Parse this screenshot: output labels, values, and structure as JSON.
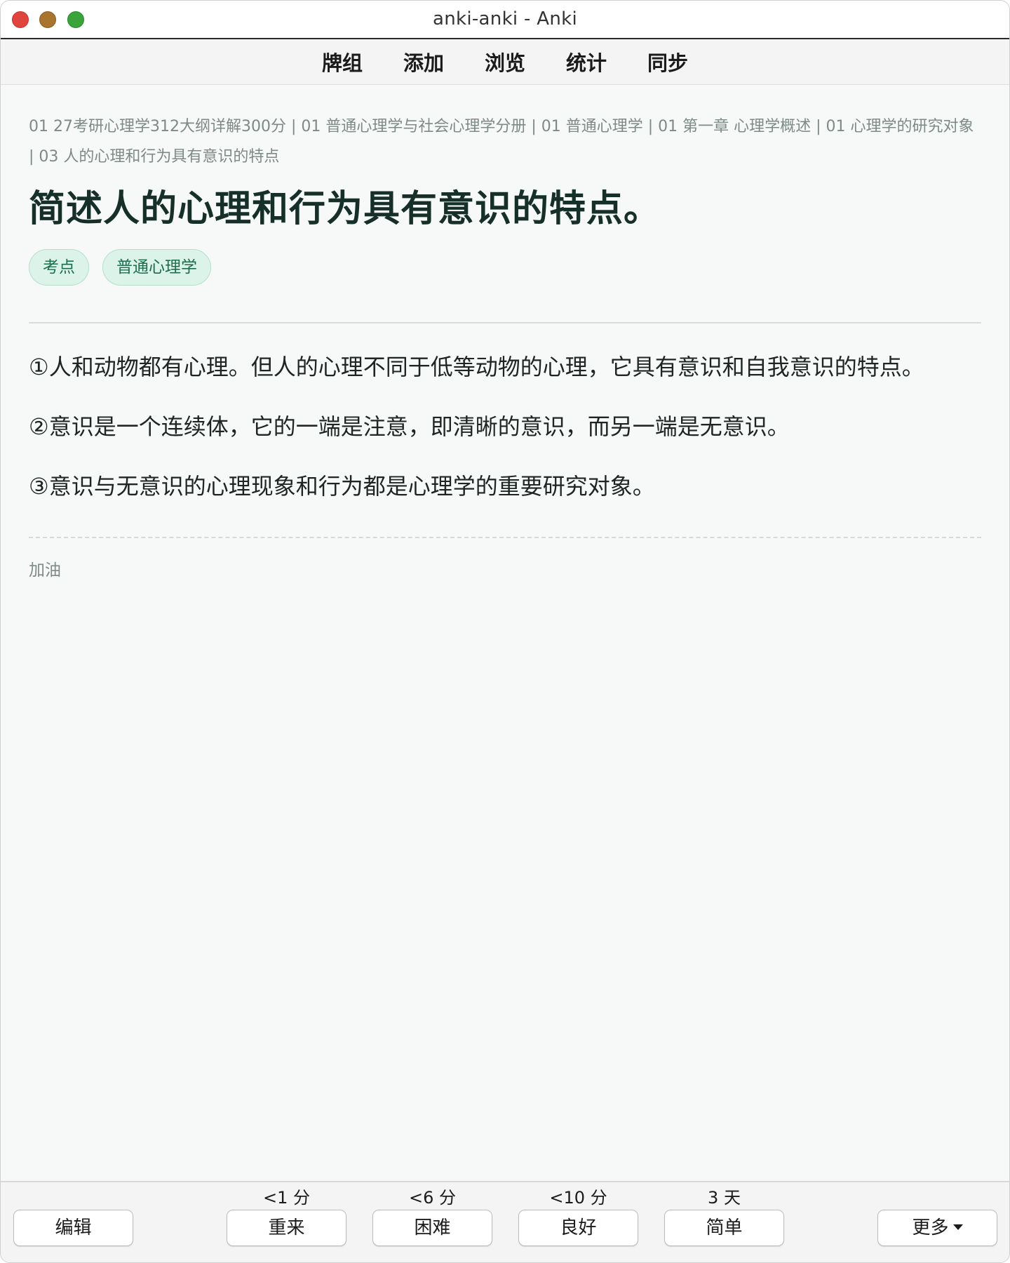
{
  "window": {
    "title": "anki-anki - Anki"
  },
  "toolbar": {
    "items": [
      "牌组",
      "添加",
      "浏览",
      "统计",
      "同步"
    ]
  },
  "card": {
    "breadcrumb": "01 27考研心理学312大纲详解300分 | 01 普通心理学与社会心理学分册 | 01 普通心理学 | 01 第一章 心理学概述 | 01 心理学的研究对象 | 03 人的心理和行为具有意识的特点",
    "question": "简述人的心理和行为具有意识的特点。",
    "tags": [
      "考点",
      "普通心理学"
    ],
    "answer": [
      "①人和动物都有心理。但人的心理不同于低等动物的心理，它具有意识和自我意识的特点。",
      "②意识是一个连续体，它的一端是注意，即清晰的意识，而另一端是无意识。",
      "③意识与无意识的心理现象和行为都是心理学的重要研究对象。"
    ],
    "extra": "加油"
  },
  "bottom": {
    "edit_label": "编辑",
    "more_label": "更多",
    "answers": [
      {
        "label": "重来",
        "interval": "<1 分"
      },
      {
        "label": "困难",
        "interval": "<6 分"
      },
      {
        "label": "良好",
        "interval": "<10 分"
      },
      {
        "label": "简单",
        "interval": "3 天"
      }
    ]
  },
  "colors": {
    "accent_tag_bg": "#dcf3e9",
    "accent_tag_text": "#1c6e4e",
    "question_text": "#163029",
    "muted_text": "#7d8a88"
  }
}
